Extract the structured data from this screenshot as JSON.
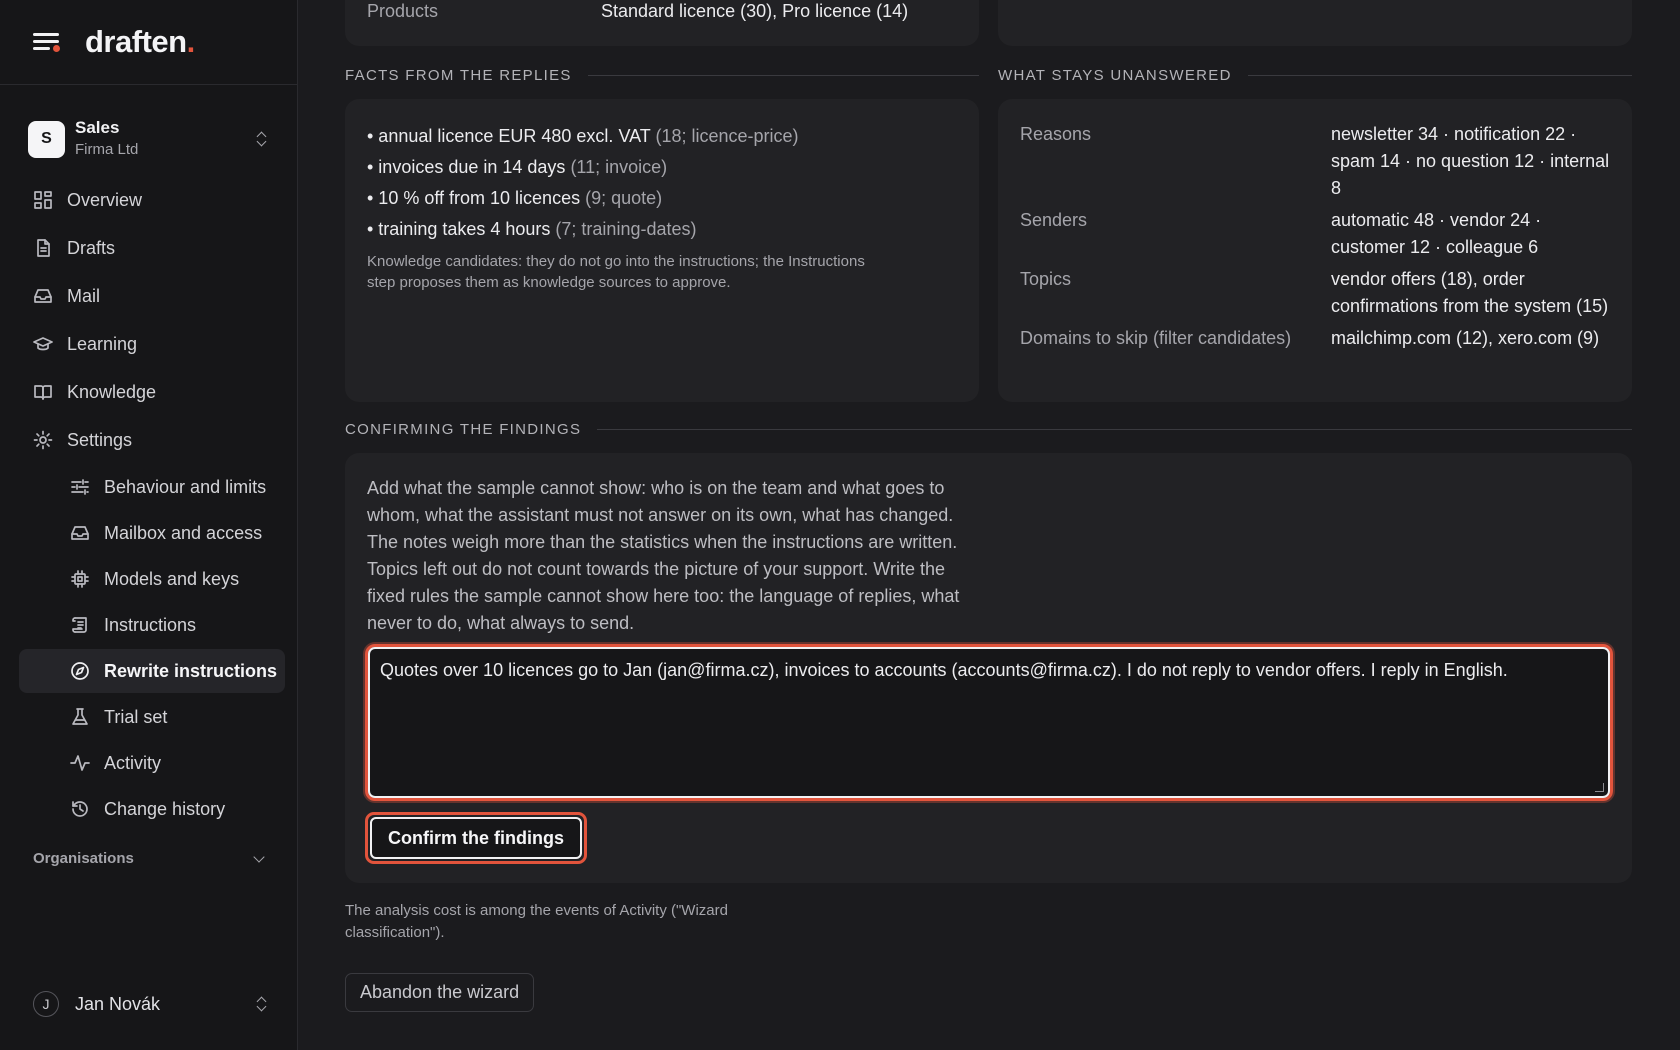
{
  "brand": {
    "name": "draften",
    "dot": "."
  },
  "org": {
    "initial": "S",
    "name": "Sales",
    "company": "Firma Ltd"
  },
  "nav": {
    "overview": "Overview",
    "drafts": "Drafts",
    "mail": "Mail",
    "learning": "Learning",
    "knowledge": "Knowledge",
    "settings": "Settings",
    "settings_items": [
      "Behaviour and limits",
      "Mailbox and access",
      "Models and keys",
      "Instructions",
      "Rewrite instructions",
      "Trial set",
      "Activity",
      "Change history"
    ],
    "active": "Rewrite instructions"
  },
  "organisations_label": "Organisations",
  "user": {
    "initial": "J",
    "name": "Jan Novák"
  },
  "products": {
    "label": "Products",
    "value": "Standard licence (30), Pro licence (14)"
  },
  "facts": {
    "title": "FACTS FROM THE REPLIES",
    "items": [
      {
        "text": "• annual licence EUR 480 excl. VAT",
        "meta": "(18; licence-price)"
      },
      {
        "text": "• invoices due in 14 days",
        "meta": "(11; invoice)"
      },
      {
        "text": "• 10 % off from 10 licences",
        "meta": "(9; quote)"
      },
      {
        "text": "• training takes 4 hours",
        "meta": "(7; training-dates)"
      }
    ],
    "note": "Knowledge candidates: they do not go into the instructions; the Instructions step proposes them as knowledge sources to approve."
  },
  "unanswered": {
    "title": "WHAT STAYS UNANSWERED",
    "rows": [
      {
        "key": "Reasons",
        "value": "newsletter 34 · notification 22 · spam 14 · no question 12 · internal 8"
      },
      {
        "key": "Senders",
        "value": "automatic 48 · vendor 24 · customer 12 · colleague 6"
      },
      {
        "key": "Topics",
        "value": "vendor offers (18), order confirmations from the system (15)"
      },
      {
        "key": "Domains to skip (filter candidates)",
        "value": "mailchimp.com (12), xero.com (9)"
      }
    ]
  },
  "confirm": {
    "title": "CONFIRMING THE FINDINGS",
    "intro": "Add what the sample cannot show: who is on the team and what goes to whom, what the assistant must not answer on its own, what has changed. The notes weigh more than the statistics when the instructions are written. Topics left out do not count towards the picture of your support. Write the fixed rules the sample cannot show here too: the language of replies, what never to do, what always to send.",
    "notes_value": "Quotes over 10 licences go to Jan (jan@firma.cz), invoices to accounts (accounts@firma.cz). I do not reply to vendor offers. I reply in English.",
    "button": "Confirm the findings"
  },
  "cost_note": "The analysis cost is among the events of Activity (\"Wizard classification\").",
  "abandon_button": "Abandon the wizard",
  "colors": {
    "accent": "#e2543c",
    "background": "#1b1b1e",
    "sidebar": "#161618",
    "card": "#222225"
  }
}
